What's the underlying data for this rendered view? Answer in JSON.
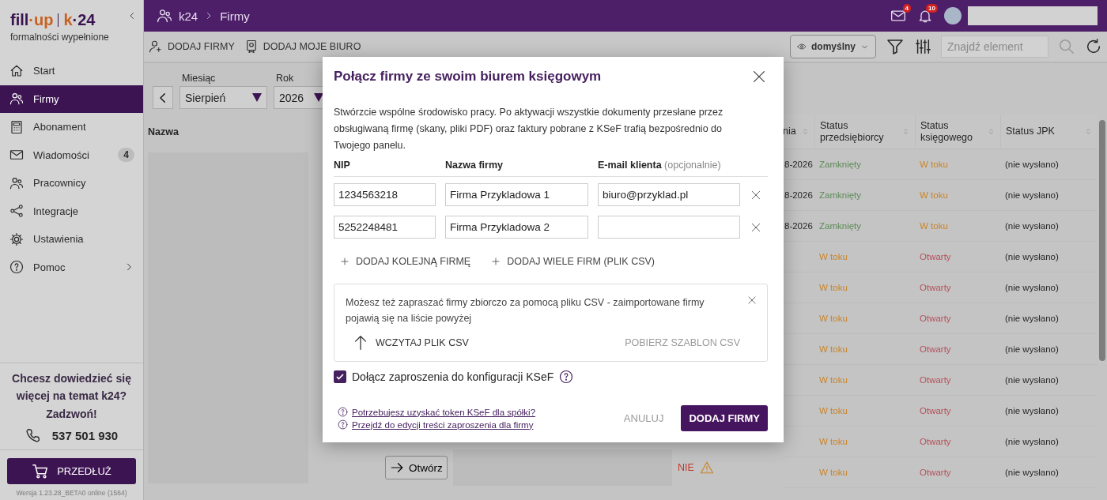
{
  "sidebar": {
    "logo": {
      "left": [
        {
          "text": "fill",
          "kind": "dark"
        },
        {
          "text": "·up",
          "kind": "accent"
        }
      ],
      "right": [
        {
          "text": "k",
          "kind": "accent"
        },
        {
          "text": "·24",
          "kind": "dark"
        }
      ],
      "tagline": "formalności wypełnione"
    },
    "items": [
      {
        "label": "Start",
        "selected": false
      },
      {
        "label": "Firmy",
        "selected": true
      },
      {
        "label": "Abonament",
        "selected": false
      },
      {
        "label": "Wiadomości",
        "selected": false,
        "badge": "4"
      },
      {
        "label": "Pracownicy",
        "selected": false
      },
      {
        "label": "Integracje",
        "selected": false
      },
      {
        "label": "Ustawienia",
        "selected": false
      },
      {
        "label": "Pomoc",
        "selected": false,
        "expandable": true
      }
    ],
    "promo": {
      "text": "Chcesz dowiedzieć się więcej na temat k24? Zadzwoń!",
      "phone": "537 501 930"
    },
    "renew_button": "PRZEDŁUŻ",
    "version": "Wersja 1.23.28_BETA0 online (1564)"
  },
  "topbar": {
    "breadcrumb": [
      "k24",
      "Firmy"
    ],
    "mail_badge": "4",
    "bell_badge": "10"
  },
  "toolbar": {
    "actions": [
      "DODAJ FIRMY",
      "DODAJ MOJE BIURO"
    ],
    "view": "domyślny",
    "search": {
      "placeholder": "Znajdź element"
    }
  },
  "filters": [
    {
      "label": "Miesiąc",
      "value": "Sierpień"
    },
    {
      "label": "Rok",
      "value": "2026"
    }
  ],
  "table": {
    "name_header": "Nazwa",
    "columns": [
      "nia",
      "Status przedsiębiorcy",
      "Status księgowego",
      "Status JPK"
    ],
    "rows": [
      {
        "date": "8-2026",
        "owner": {
          "text": "Zamknięty",
          "kind": "closed"
        },
        "accountant": {
          "text": "W toku",
          "kind": "progress"
        },
        "jpk": "(nie wysłano)"
      },
      {
        "date": "8-2026",
        "owner": {
          "text": "Zamknięty",
          "kind": "closed"
        },
        "accountant": {
          "text": "W toku",
          "kind": "progress"
        },
        "jpk": "(nie wysłano)"
      },
      {
        "date": "8-2026",
        "owner": {
          "text": "Zamknięty",
          "kind": "closed"
        },
        "accountant": {
          "text": "W toku",
          "kind": "progress"
        },
        "jpk": "(nie wysłano)"
      },
      {
        "owner": {
          "text": "W toku",
          "kind": "progress"
        },
        "accountant": {
          "text": "Otwarty",
          "kind": "open"
        },
        "jpk": "(nie wysłano)"
      },
      {
        "owner": {
          "text": "W toku",
          "kind": "progress"
        },
        "accountant": {
          "text": "Otwarty",
          "kind": "open"
        },
        "jpk": "(nie wysłano)"
      },
      {
        "owner": {
          "text": "W toku",
          "kind": "progress"
        },
        "accountant": {
          "text": "Otwarty",
          "kind": "open"
        },
        "jpk": "(nie wysłano)"
      },
      {
        "owner": {
          "text": "W toku",
          "kind": "progress"
        },
        "accountant": {
          "text": "Otwarty",
          "kind": "open"
        },
        "jpk": "(nie wysłano)"
      },
      {
        "owner": {
          "text": "W toku",
          "kind": "progress"
        },
        "accountant": {
          "text": "Otwarty",
          "kind": "open"
        },
        "jpk": "(nie wysłano)"
      },
      {
        "owner": {
          "text": "W toku",
          "kind": "progress"
        },
        "accountant": {
          "text": "Otwarty",
          "kind": "open"
        },
        "jpk": "(nie wysłano)"
      },
      {
        "owner": {
          "text": "W toku",
          "kind": "progress"
        },
        "accountant": {
          "text": "Otwarty",
          "kind": "open"
        },
        "jpk": "(nie wysłano)"
      },
      {
        "owner": {
          "text": "W toku",
          "kind": "progress"
        },
        "accountant": {
          "text": "Otwarty",
          "kind": "open"
        },
        "jpk": "(nie wysłano)"
      }
    ],
    "bottom_row": {
      "button": "Otwórz",
      "flag": "NIE"
    }
  },
  "modal": {
    "title": "Połącz firmy ze swoim biurem księgowym",
    "description": "Stwórzcie wspólne środowisko pracy. Po aktywacji wszystkie dokumenty przesłane przez obsługiwaną firmę (skany, pliki PDF) oraz faktury pobrane z KSeF trafią bezpośrednio do Twojego panelu.",
    "columns": [
      {
        "label": "NIP"
      },
      {
        "label": "Nazwa firmy"
      },
      {
        "label": "E-mail klienta",
        "hint": "(opcjonalnie)"
      }
    ],
    "rows": [
      {
        "nip": "1234563218",
        "name": "Firma Przykladowa 1",
        "email": "biuro@przyklad.pl"
      },
      {
        "nip": "5252248481",
        "name": "Firma Przykladowa 2"
      }
    ],
    "add_links": [
      "DODAJ KOLEJNĄ FIRMĘ",
      "DODAJ WIELE FIRM (PLIK CSV)"
    ],
    "csv_box": {
      "text": "Możesz też zapraszać firmy zbiorczo za pomocą pliku CSV - zaimportowane firmy pojawią się na liście powyżej",
      "upload": "WCZYTAJ PLIK CSV",
      "template": {
        "label": "POBIERZ SZABLON CSV",
        "disabled": true
      }
    },
    "ksef_checkbox": {
      "label": "Dołącz zaproszenia do konfiguracji KSeF",
      "checked": true
    },
    "help_links": [
      "Potrzebujesz uzyskać token KSeF dla spółki?",
      "Przejdź do edycji treści zaproszenia dla firmy"
    ],
    "cancel": "ANULUJ",
    "submit": "DODAJ FIRMY"
  }
}
